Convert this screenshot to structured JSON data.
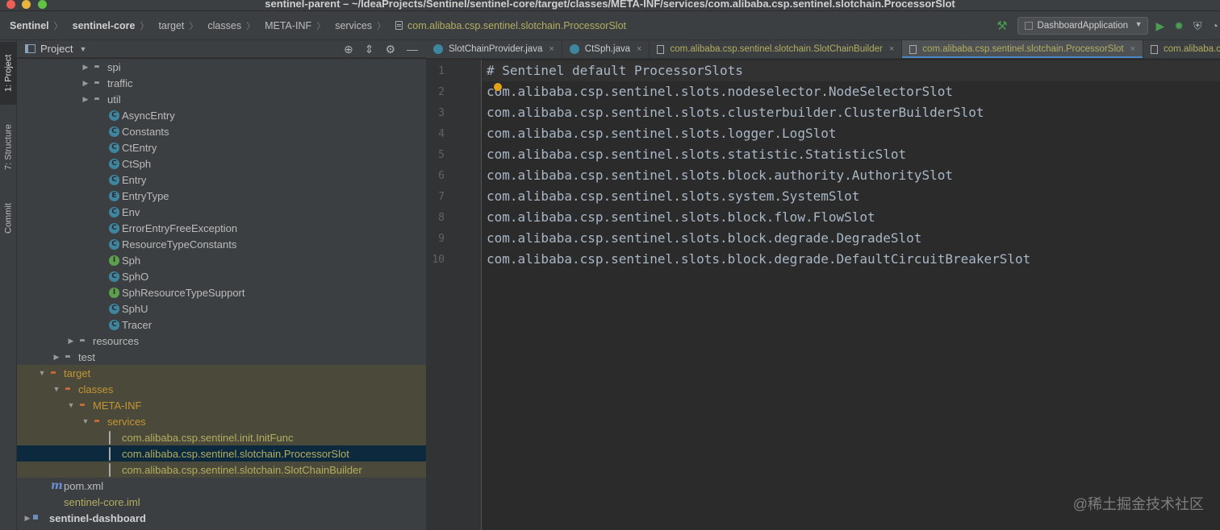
{
  "window": {
    "title": "sentinel-parent – ~/IdeaProjects/Sentinel/sentinel-core/target/classes/META-INF/services/com.alibaba.csp.sentinel.slotchain.ProcessorSlot"
  },
  "breadcrumb": {
    "items": [
      "Sentinel",
      "sentinel-core",
      "target",
      "classes",
      "META-INF",
      "services"
    ],
    "file": "com.alibaba.csp.sentinel.slotchain.ProcessorSlot"
  },
  "toolbar": {
    "run_config": "DashboardApplication",
    "icons": [
      "hammer-icon",
      "run-icon",
      "debug-icon",
      "coverage-icon",
      "profile-icon"
    ]
  },
  "toolstrip": {
    "project_tab": "1: Project",
    "structure_tab": "7: Structure",
    "commit_tab": "Commit"
  },
  "project_panel": {
    "title": "Project",
    "tree": [
      {
        "label": "spi",
        "icon": "package-icon",
        "arrow": "▶",
        "color": "default"
      },
      {
        "label": "traffic",
        "icon": "package-icon",
        "arrow": "▶",
        "color": "default"
      },
      {
        "label": "util",
        "icon": "package-icon",
        "arrow": "▶",
        "color": "default"
      },
      {
        "label": "AsyncEntry",
        "icon": "class-icon",
        "arrow": "",
        "color": "default"
      },
      {
        "label": "Constants",
        "icon": "class-icon",
        "arrow": "",
        "color": "default"
      },
      {
        "label": "CtEntry",
        "icon": "class-icon",
        "arrow": "",
        "color": "default"
      },
      {
        "label": "CtSph",
        "icon": "class-icon",
        "arrow": "",
        "color": "default"
      },
      {
        "label": "Entry",
        "icon": "abstract-class-icon",
        "arrow": "",
        "color": "default"
      },
      {
        "label": "EntryType",
        "icon": "enum-icon",
        "arrow": "",
        "color": "default"
      },
      {
        "label": "Env",
        "icon": "class-icon",
        "arrow": "",
        "color": "default"
      },
      {
        "label": "ErrorEntryFreeException",
        "icon": "class-icon",
        "arrow": "",
        "color": "default"
      },
      {
        "label": "ResourceTypeConstants",
        "icon": "class-icon",
        "arrow": "",
        "color": "default"
      },
      {
        "label": "Sph",
        "icon": "interface-icon",
        "arrow": "",
        "color": "default"
      },
      {
        "label": "SphO",
        "icon": "class-icon",
        "arrow": "",
        "color": "default"
      },
      {
        "label": "SphResourceTypeSupport",
        "icon": "interface-icon",
        "arrow": "",
        "color": "default"
      },
      {
        "label": "SphU",
        "icon": "class-icon",
        "arrow": "",
        "color": "default"
      },
      {
        "label": "Tracer",
        "icon": "class-icon",
        "arrow": "",
        "color": "default"
      },
      {
        "label": "resources",
        "icon": "resources-folder-icon",
        "arrow": "▶",
        "color": "default"
      },
      {
        "label": "test",
        "icon": "folder-icon",
        "arrow": "▶",
        "color": "default"
      },
      {
        "label": "target",
        "icon": "excluded-folder-icon",
        "arrow": "▼",
        "color": "excluded"
      },
      {
        "label": "classes",
        "icon": "excluded-folder-icon",
        "arrow": "▼",
        "color": "excluded"
      },
      {
        "label": "META-INF",
        "icon": "excluded-folder-icon",
        "arrow": "▼",
        "color": "excluded"
      },
      {
        "label": "services",
        "icon": "excluded-folder-icon",
        "arrow": "▼",
        "color": "excluded"
      },
      {
        "label": "com.alibaba.csp.sentinel.init.InitFunc",
        "icon": "text-file-icon",
        "arrow": "",
        "color": "yellow"
      },
      {
        "label": "com.alibaba.csp.sentinel.slotchain.ProcessorSlot",
        "icon": "text-file-icon",
        "arrow": "",
        "color": "yellow"
      },
      {
        "label": "com.alibaba.csp.sentinel.slotchain.SlotChainBuilder",
        "icon": "text-file-icon",
        "arrow": "",
        "color": "yellow"
      },
      {
        "label": "pom.xml",
        "icon": "maven-icon",
        "arrow": "",
        "color": "default"
      },
      {
        "label": "sentinel-core.iml",
        "icon": "iml-file-icon",
        "arrow": "",
        "color": "yellow"
      },
      {
        "label": "sentinel-dashboard",
        "icon": "module-folder-icon",
        "arrow": "▶",
        "color": "bold"
      }
    ]
  },
  "editor": {
    "tabs": [
      {
        "label": "SlotChainProvider.java",
        "icon": "class-icon",
        "modified": false,
        "active": false
      },
      {
        "label": "CtSph.java",
        "icon": "class-icon",
        "modified": false,
        "active": false
      },
      {
        "label": "com.alibaba.csp.sentinel.slotchain.SlotChainBuilder",
        "icon": "text-file-icon",
        "modified": true,
        "active": false
      },
      {
        "label": "com.alibaba.csp.sentinel.slotchain.ProcessorSlot",
        "icon": "text-file-icon",
        "modified": true,
        "active": true
      },
      {
        "label": "com.alibaba.csp.sentinel.init.InitFunc",
        "icon": "text-file-icon",
        "modified": true,
        "active": false
      }
    ],
    "lines": [
      {
        "num": "1",
        "text": "# Sentinel default ProcessorSlots"
      },
      {
        "num": "2",
        "text": "com.alibaba.csp.sentinel.slots.nodeselector.NodeSelectorSlot"
      },
      {
        "num": "3",
        "text": "com.alibaba.csp.sentinel.slots.clusterbuilder.ClusterBuilderSlot"
      },
      {
        "num": "4",
        "text": "com.alibaba.csp.sentinel.slots.logger.LogSlot"
      },
      {
        "num": "5",
        "text": "com.alibaba.csp.sentinel.slots.statistic.StatisticSlot"
      },
      {
        "num": "6",
        "text": "com.alibaba.csp.sentinel.slots.block.authority.AuthoritySlot"
      },
      {
        "num": "7",
        "text": "com.alibaba.csp.sentinel.slots.system.SystemSlot"
      },
      {
        "num": "8",
        "text": "com.alibaba.csp.sentinel.slots.block.flow.FlowSlot"
      },
      {
        "num": "9",
        "text": "com.alibaba.csp.sentinel.slots.block.degrade.DegradeSlot"
      },
      {
        "num": "10",
        "text": "com.alibaba.csp.sentinel.slots.block.degrade.DefaultCircuitBreakerSlot"
      }
    ]
  },
  "watermark": "@稀土掘金技术社区",
  "colors": {
    "accent": "#4a88c7",
    "selection": "#0d293e",
    "excluded": "#c39533",
    "modified": "#b3ae60",
    "run": "#499c54"
  }
}
